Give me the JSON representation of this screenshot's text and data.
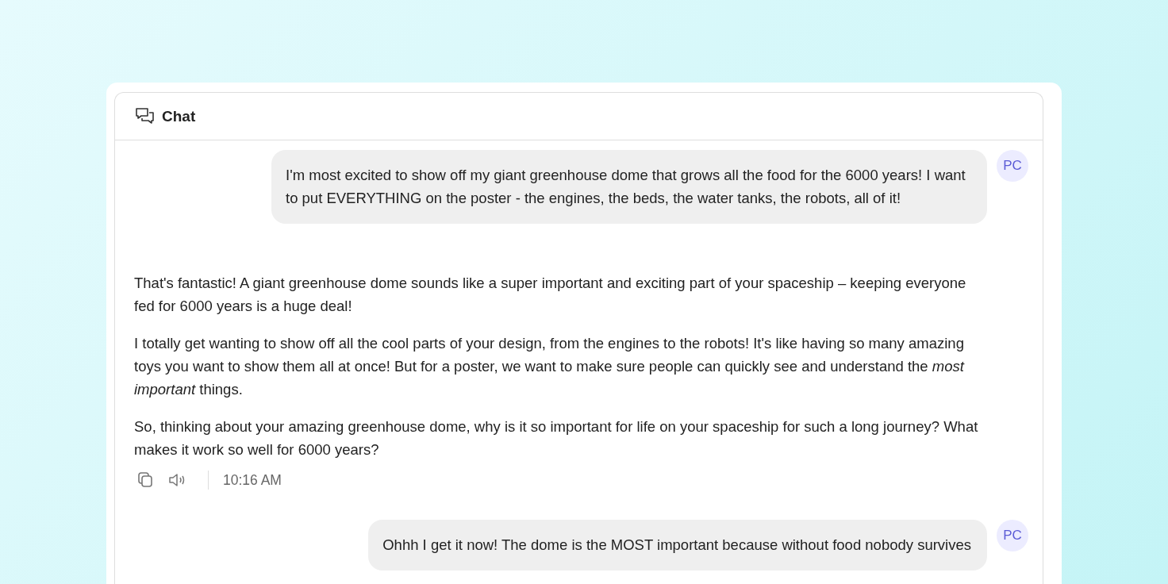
{
  "chat": {
    "title": "Chat"
  },
  "messages": [
    {
      "kind": "user",
      "avatar": "PC",
      "text": "I'm most excited to show off my giant greenhouse dome that grows all the food for the 6000 years! I want to put EVERYTHING on the poster - the engines, the beds, the water tanks, the robots, all of it!"
    },
    {
      "kind": "assistant",
      "paragraphs": [
        "That's fantastic! A giant greenhouse dome sounds like a super important and exciting part of your spaceship – keeping everyone fed for 6000 years is a huge deal!",
        "I totally get wanting to show off all the cool parts of your design, from the engines to the robots! It's like having so many amazing toys you want to show them all at once! But for a poster, we want to make sure people can quickly see and understand the *most important* things.",
        "So, thinking about your amazing greenhouse dome, why is it so important for life on your spaceship for such a long journey? What makes it work so well for 6000 years?"
      ],
      "time": "10:16 AM"
    },
    {
      "kind": "user",
      "avatar": "PC",
      "text": "Ohhh I get it now! The dome is the MOST important because without food nobody survives"
    }
  ]
}
